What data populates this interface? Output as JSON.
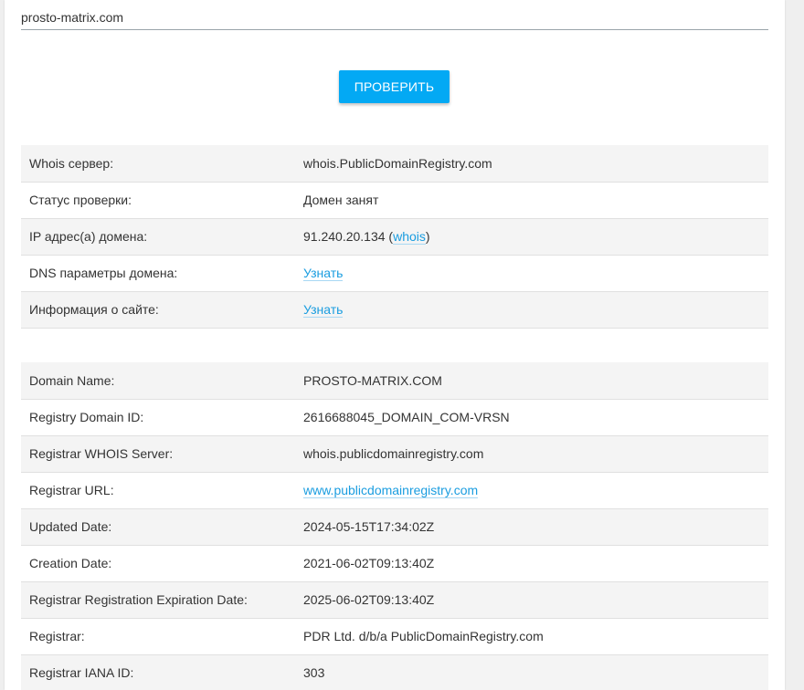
{
  "form": {
    "domain_value": "prosto-matrix.com",
    "check_button": "ПРОВЕРИТЬ"
  },
  "status_table": {
    "rows": [
      {
        "label": "Whois сервер:",
        "value": "whois.PublicDomainRegistry.com"
      },
      {
        "label": "Статус проверки:",
        "value": "Домен занят"
      },
      {
        "label": "IP адрес(а) домена:",
        "ip": "91.240.20.134",
        "open_paren": "(",
        "link": "whois",
        "close_paren": ")"
      },
      {
        "label": "DNS параметры домена:",
        "link": "Узнать"
      },
      {
        "label": "Информация о сайте:",
        "link": "Узнать"
      }
    ]
  },
  "whois_table": {
    "rows": [
      {
        "label": "Domain Name:",
        "value": "PROSTO-MATRIX.COM"
      },
      {
        "label": "Registry Domain ID:",
        "value": "2616688045_DOMAIN_COM-VRSN"
      },
      {
        "label": "Registrar WHOIS Server:",
        "value": "whois.publicdomainregistry.com"
      },
      {
        "label": "Registrar URL:",
        "link": "www.publicdomainregistry.com"
      },
      {
        "label": "Updated Date:",
        "value": "2024-05-15T17:34:02Z"
      },
      {
        "label": "Creation Date:",
        "value": "2021-06-02T09:13:40Z"
      },
      {
        "label": "Registrar Registration Expiration Date:",
        "value": "2025-06-02T09:13:40Z"
      },
      {
        "label": "Registrar:",
        "value": "PDR Ltd. d/b/a PublicDomainRegistry.com"
      },
      {
        "label": "Registrar IANA ID:",
        "value": "303"
      }
    ]
  },
  "colors": {
    "accent": "#03a9f4",
    "link": "#1a9de0",
    "row_alt": "#f4f4f4"
  }
}
